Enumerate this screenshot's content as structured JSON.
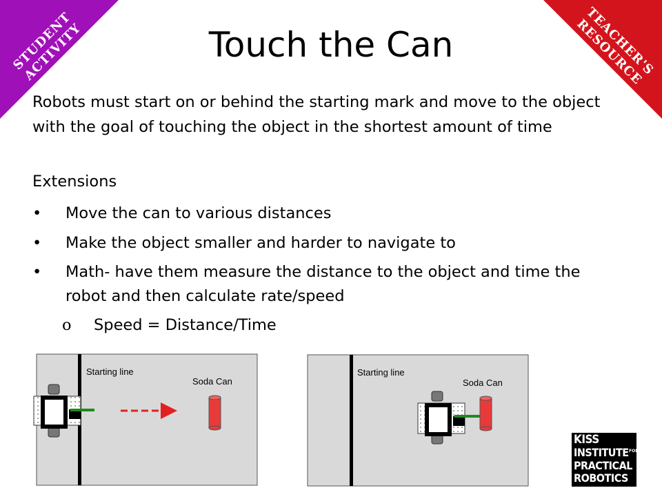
{
  "title": "Touch the Can",
  "badges": {
    "student": {
      "line1": "STUDENT",
      "line2": "ACTIVITY",
      "color": "#a010b8"
    },
    "teacher": {
      "line1": "TEACHER'S",
      "line2": "RESOURCE",
      "color": "#d4141c"
    }
  },
  "intro_line1": "Robots must start on or behind the starting mark and move to the object",
  "intro_line2": "with the goal of touching the object in the shortest amount of time",
  "extensions": {
    "heading": "Extensions",
    "bullets": [
      {
        "marker": "•",
        "text": "Move the can to various distances"
      },
      {
        "marker": "•",
        "text": "Make the object smaller and harder to navigate to"
      },
      {
        "marker": "•",
        "line1": "Math- have them measure the distance to the object and time the",
        "line2": "robot and then calculate rate/speed"
      }
    ],
    "sub_bullet": {
      "marker": "o",
      "text": "Speed = Distance/Time"
    }
  },
  "diagrams": [
    {
      "starting_line_label": "Starting line",
      "can_label": "Soda Can"
    },
    {
      "starting_line_label": "Starting line",
      "can_label": "Soda Can"
    }
  ],
  "logo": {
    "line1": "KISS",
    "line2": "INSTITUTE",
    "for": "FOR",
    "line3": "PRACTICAL",
    "line4": "ROBOTICS"
  },
  "colors": {
    "can_red": "#e83a3a",
    "arm_green": "#1e8a1e",
    "arrow_red": "#e32020",
    "board_grey": "#d9d9d9"
  }
}
